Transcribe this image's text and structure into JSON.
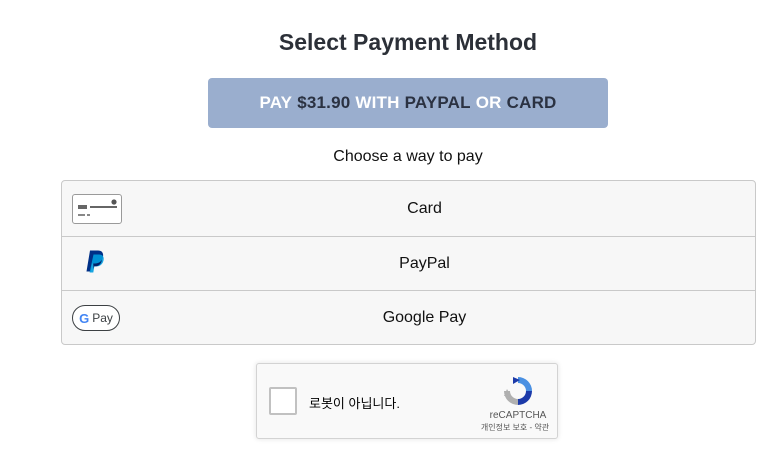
{
  "page": {
    "title": "Select Payment Method"
  },
  "pay_banner": {
    "pay": "PAY",
    "amount": "$31.90",
    "with": "WITH",
    "paypal": "PAYPAL",
    "or": "OR",
    "card": "CARD",
    "background_color": "#9aaece"
  },
  "choose": {
    "text": "Choose a way to pay"
  },
  "methods": [
    {
      "label": "Card",
      "icon": "credit-card-icon"
    },
    {
      "label": "PayPal",
      "icon": "paypal-icon"
    },
    {
      "label": "Google Pay",
      "icon": "google-pay-icon"
    }
  ],
  "google_pay_badge": {
    "g": "G",
    "pay": "Pay"
  },
  "recaptcha": {
    "label": "로봇이 아닙니다.",
    "brand": "reCAPTCHA",
    "links": "개인정보 보호 - 약관"
  },
  "colors": {
    "paypal_dark": "#003087",
    "paypal_light": "#009cde",
    "recaptcha_blue": "#1c3aa9",
    "recaptcha_light": "#4a90e2"
  }
}
